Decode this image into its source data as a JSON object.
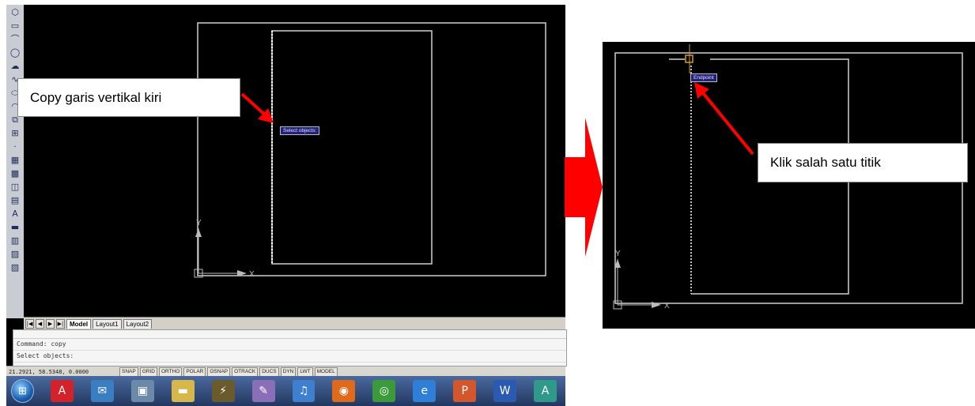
{
  "left_screenshot": {
    "toolbar_icons": [
      "polygon-icon",
      "rectangle-icon",
      "arc-icon",
      "circle-icon",
      "revision-cloud-icon",
      "spline-icon",
      "ellipse-icon",
      "ellipse-arc-icon",
      "insert-block-icon",
      "make-block-icon",
      "point-icon",
      "hatch-icon",
      "gradient-icon",
      "region-icon",
      "table-icon",
      "multiline-text-icon",
      "sheet-icon",
      "layer-icon",
      "image-icon",
      "toolbar-icon"
    ],
    "toolbar_glyphs": [
      "⬡",
      "▭",
      "⌒",
      "◯",
      "☁",
      "∿",
      "⬭",
      "◠",
      "⧉",
      "⊞",
      "·",
      "▦",
      "▩",
      "◫",
      "▤",
      "A",
      "▬",
      "▥",
      "▨",
      "▧"
    ],
    "tooltip": "Select objects:",
    "ucs_labels": {
      "y": "Y",
      "x": "X"
    },
    "layout_tabs": {
      "nav": [
        "|◀",
        "◀",
        "▶",
        "▶|"
      ],
      "tabs": [
        "Model",
        "Layout1",
        "Layout2"
      ],
      "active": "Model"
    },
    "command_window": {
      "line1": "Command: copy",
      "line2": "Select objects:"
    },
    "status_bar": {
      "coords": "21.2921, 58.5348, 0.0000",
      "buttons": [
        "SNAP",
        "GRID",
        "ORTHO",
        "POLAR",
        "OSNAP",
        "OTRACK",
        "DUCS",
        "DYN",
        "LWT",
        "MODEL"
      ]
    },
    "taskbar": {
      "start_icon": "windows-start-icon",
      "apps": [
        {
          "name": "acrobat-icon",
          "color": "#d3222a",
          "glyph": "A"
        },
        {
          "name": "messenger-icon",
          "color": "#3a7ec2",
          "glyph": "✉"
        },
        {
          "name": "explorer-files-icon",
          "color": "#6c8aa8",
          "glyph": "▣"
        },
        {
          "name": "folder-icon",
          "color": "#d7b64a",
          "glyph": "▬"
        },
        {
          "name": "winamp-icon",
          "color": "#6a5a2c",
          "glyph": "⚡"
        },
        {
          "name": "paint-icon",
          "color": "#8a6fb8",
          "glyph": "✎"
        },
        {
          "name": "itunes-icon",
          "color": "#3f7fd0",
          "glyph": "♫"
        },
        {
          "name": "firefox-icon",
          "color": "#e06a1c",
          "glyph": "◉"
        },
        {
          "name": "chrome-icon",
          "color": "#3b9b3b",
          "glyph": "◎"
        },
        {
          "name": "internet-explorer-icon",
          "color": "#2f7ed8",
          "glyph": "e"
        },
        {
          "name": "powerpoint-icon",
          "color": "#d2572d",
          "glyph": "P"
        },
        {
          "name": "word-icon",
          "color": "#2b5ab3",
          "glyph": "W"
        },
        {
          "name": "autocad-icon",
          "color": "#2f9a8a",
          "glyph": "A"
        }
      ]
    }
  },
  "right_screenshot": {
    "tooltip": "Endpoint",
    "ucs_labels": {
      "y": "Y",
      "x": "X"
    }
  },
  "callouts": {
    "left": "Copy garis vertikal kiri",
    "right": "Klik salah satu titik"
  },
  "colors": {
    "arrow_red": "#ff0000",
    "cad_line": "#d8d8d8",
    "tooltip_bg": "#22227a",
    "snap_marker": "#d29a2a"
  }
}
